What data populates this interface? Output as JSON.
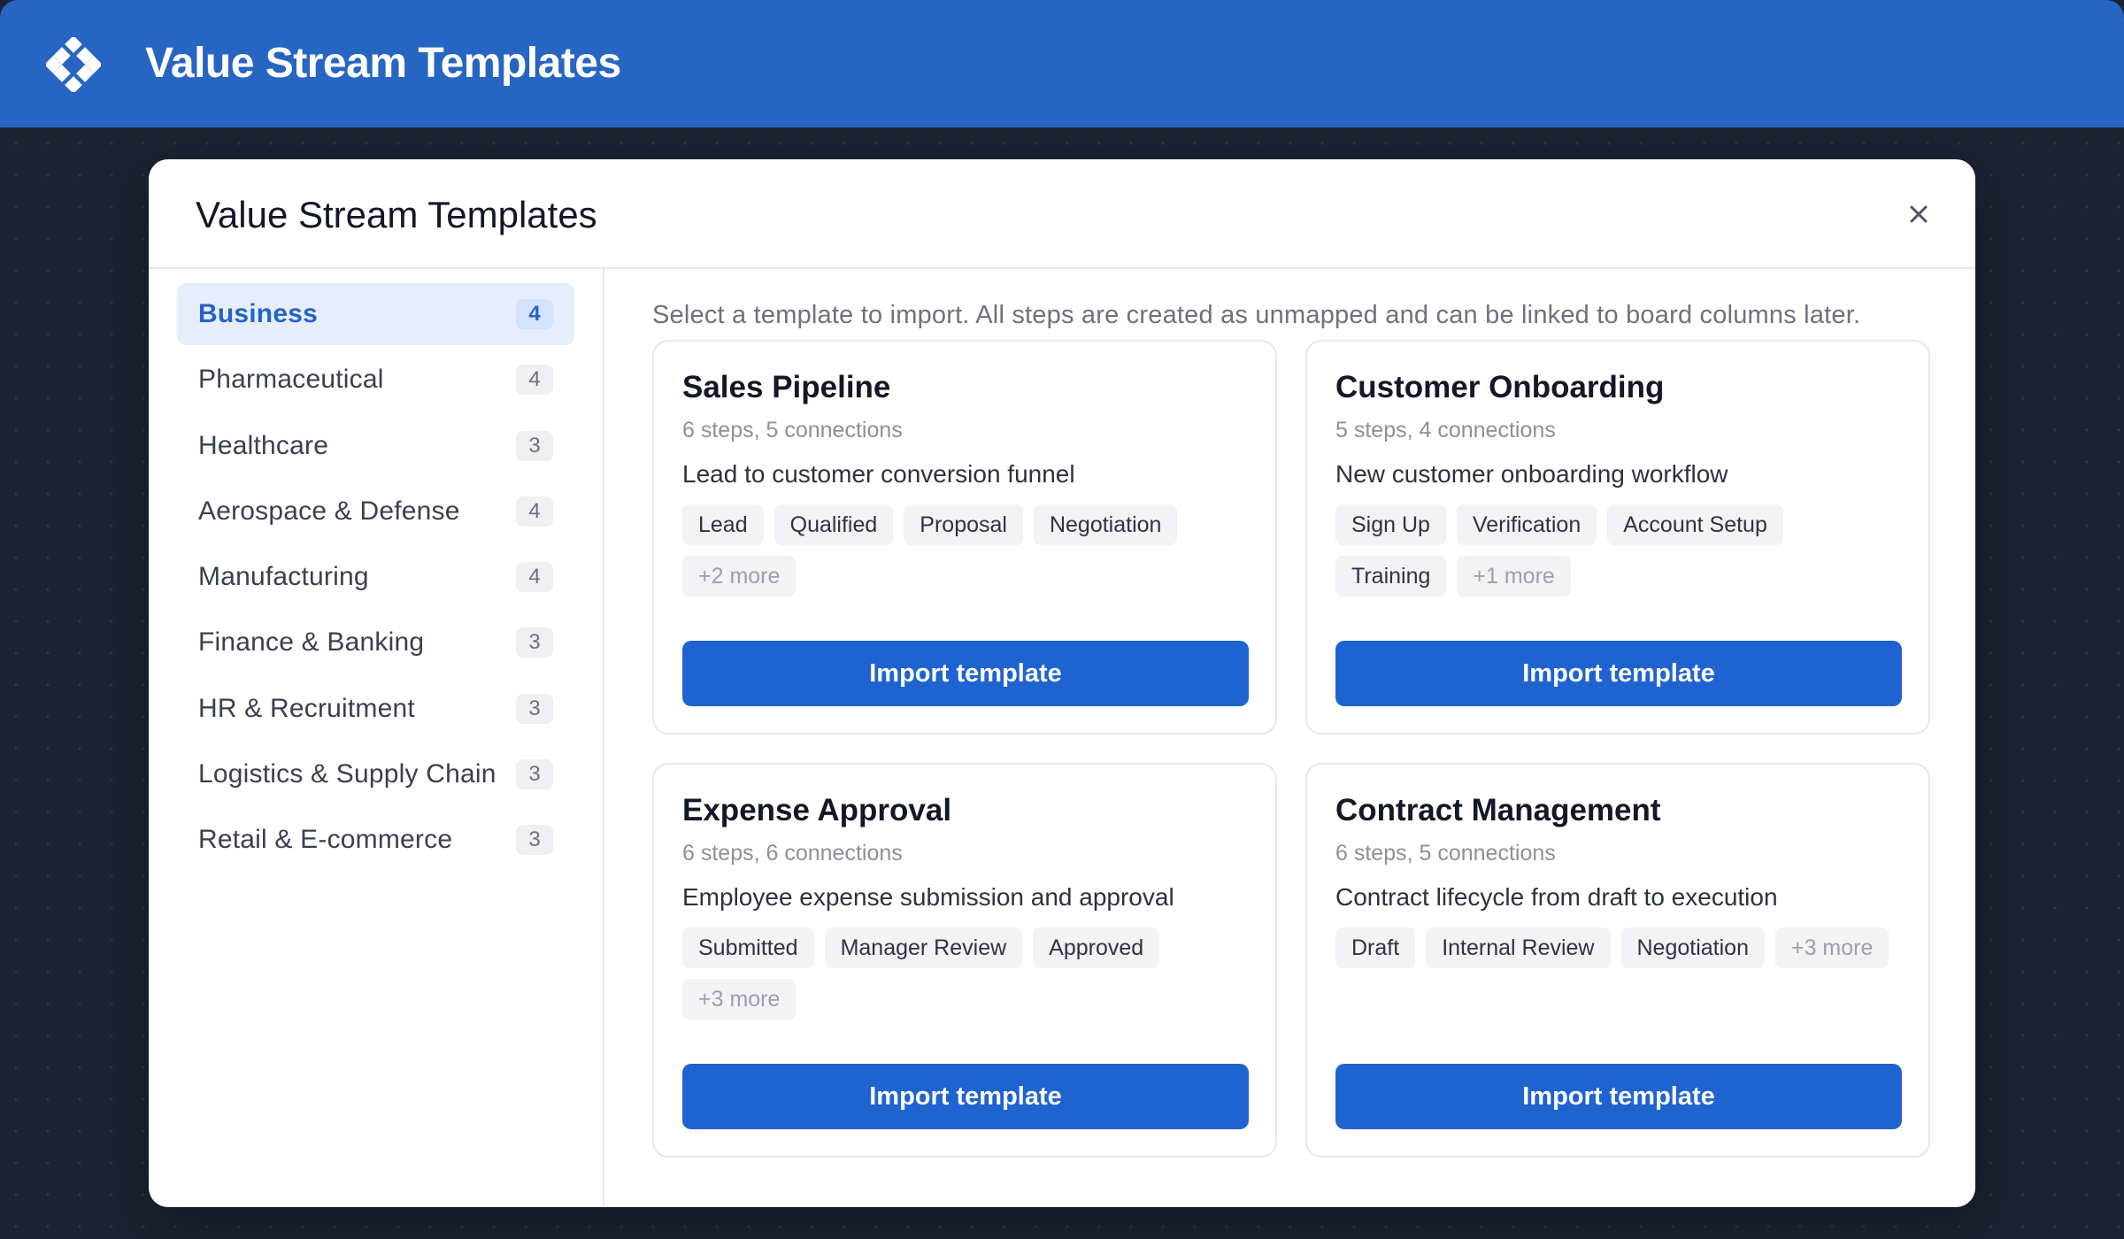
{
  "app": {
    "title": "Value Stream Templates",
    "logo_icon": "diamond-grid-logo-icon"
  },
  "modal": {
    "title": "Value Stream Templates",
    "close_icon": "close-icon",
    "intro": "Select a template to import. All steps are created as unmapped and can be linked to board columns later."
  },
  "sidebar": {
    "items": [
      {
        "label": "Business",
        "count": "4",
        "active": true
      },
      {
        "label": "Pharmaceutical",
        "count": "4"
      },
      {
        "label": "Healthcare",
        "count": "3"
      },
      {
        "label": "Aerospace & Defense",
        "count": "4"
      },
      {
        "label": "Manufacturing",
        "count": "4"
      },
      {
        "label": "Finance & Banking",
        "count": "3"
      },
      {
        "label": "HR & Recruitment",
        "count": "3"
      },
      {
        "label": "Logistics & Supply Chain",
        "count": "3"
      },
      {
        "label": "Retail & E-commerce",
        "count": "3"
      }
    ]
  },
  "templates": [
    {
      "title": "Sales Pipeline",
      "meta": "6 steps, 5 connections",
      "description": "Lead to customer conversion funnel",
      "tags": [
        "Lead",
        "Qualified",
        "Proposal",
        "Negotiation"
      ],
      "more": "+2 more",
      "button": "Import template"
    },
    {
      "title": "Customer Onboarding",
      "meta": "5 steps, 4 connections",
      "description": "New customer onboarding workflow",
      "tags": [
        "Sign Up",
        "Verification",
        "Account Setup",
        "Training"
      ],
      "more": "+1 more",
      "button": "Import template"
    },
    {
      "title": "Expense Approval",
      "meta": "6 steps, 6 connections",
      "description": "Employee expense submission and approval",
      "tags": [
        "Submitted",
        "Manager Review",
        "Approved"
      ],
      "more": "+3 more",
      "button": "Import template"
    },
    {
      "title": "Contract Management",
      "meta": "6 steps, 5 connections",
      "description": "Contract lifecycle from draft to execution",
      "tags": [
        "Draft",
        "Internal Review",
        "Negotiation"
      ],
      "more": "+3 more",
      "button": "Import template"
    }
  ],
  "colors": {
    "topbar": "#2666c2",
    "accent": "#1e63d0",
    "active_bg": "#e6eefd",
    "backdrop": "#1c2333"
  }
}
